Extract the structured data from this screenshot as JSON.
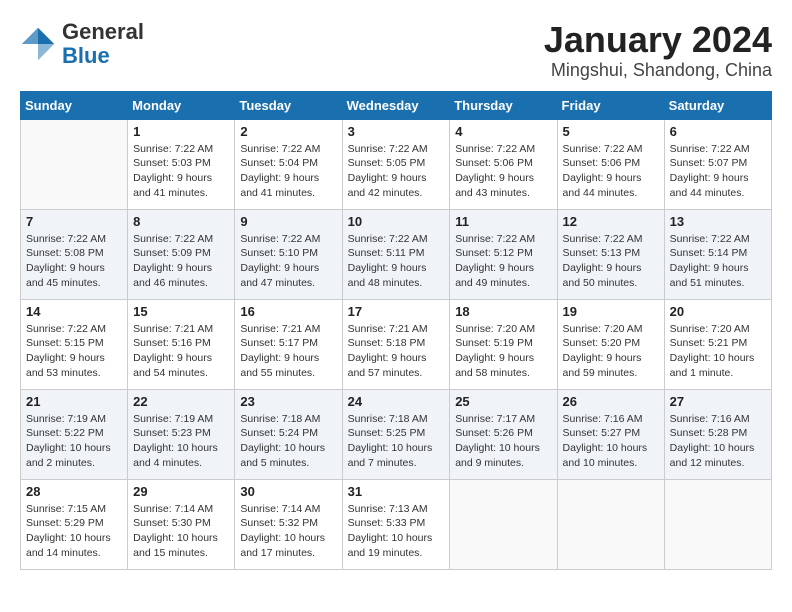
{
  "header": {
    "logo": {
      "general": "General",
      "blue": "Blue"
    },
    "title": "January 2024",
    "location": "Mingshui, Shandong, China"
  },
  "weekdays": [
    "Sunday",
    "Monday",
    "Tuesday",
    "Wednesday",
    "Thursday",
    "Friday",
    "Saturday"
  ],
  "weeks": [
    [
      {
        "day": null
      },
      {
        "day": "1",
        "sunrise": "7:22 AM",
        "sunset": "5:03 PM",
        "daylight": "9 hours and 41 minutes."
      },
      {
        "day": "2",
        "sunrise": "7:22 AM",
        "sunset": "5:04 PM",
        "daylight": "9 hours and 41 minutes."
      },
      {
        "day": "3",
        "sunrise": "7:22 AM",
        "sunset": "5:05 PM",
        "daylight": "9 hours and 42 minutes."
      },
      {
        "day": "4",
        "sunrise": "7:22 AM",
        "sunset": "5:06 PM",
        "daylight": "9 hours and 43 minutes."
      },
      {
        "day": "5",
        "sunrise": "7:22 AM",
        "sunset": "5:06 PM",
        "daylight": "9 hours and 44 minutes."
      },
      {
        "day": "6",
        "sunrise": "7:22 AM",
        "sunset": "5:07 PM",
        "daylight": "9 hours and 44 minutes."
      }
    ],
    [
      {
        "day": "7",
        "sunrise": "7:22 AM",
        "sunset": "5:08 PM",
        "daylight": "9 hours and 45 minutes."
      },
      {
        "day": "8",
        "sunrise": "7:22 AM",
        "sunset": "5:09 PM",
        "daylight": "9 hours and 46 minutes."
      },
      {
        "day": "9",
        "sunrise": "7:22 AM",
        "sunset": "5:10 PM",
        "daylight": "9 hours and 47 minutes."
      },
      {
        "day": "10",
        "sunrise": "7:22 AM",
        "sunset": "5:11 PM",
        "daylight": "9 hours and 48 minutes."
      },
      {
        "day": "11",
        "sunrise": "7:22 AM",
        "sunset": "5:12 PM",
        "daylight": "9 hours and 49 minutes."
      },
      {
        "day": "12",
        "sunrise": "7:22 AM",
        "sunset": "5:13 PM",
        "daylight": "9 hours and 50 minutes."
      },
      {
        "day": "13",
        "sunrise": "7:22 AM",
        "sunset": "5:14 PM",
        "daylight": "9 hours and 51 minutes."
      }
    ],
    [
      {
        "day": "14",
        "sunrise": "7:22 AM",
        "sunset": "5:15 PM",
        "daylight": "9 hours and 53 minutes."
      },
      {
        "day": "15",
        "sunrise": "7:21 AM",
        "sunset": "5:16 PM",
        "daylight": "9 hours and 54 minutes."
      },
      {
        "day": "16",
        "sunrise": "7:21 AM",
        "sunset": "5:17 PM",
        "daylight": "9 hours and 55 minutes."
      },
      {
        "day": "17",
        "sunrise": "7:21 AM",
        "sunset": "5:18 PM",
        "daylight": "9 hours and 57 minutes."
      },
      {
        "day": "18",
        "sunrise": "7:20 AM",
        "sunset": "5:19 PM",
        "daylight": "9 hours and 58 minutes."
      },
      {
        "day": "19",
        "sunrise": "7:20 AM",
        "sunset": "5:20 PM",
        "daylight": "9 hours and 59 minutes."
      },
      {
        "day": "20",
        "sunrise": "7:20 AM",
        "sunset": "5:21 PM",
        "daylight": "10 hours and 1 minute."
      }
    ],
    [
      {
        "day": "21",
        "sunrise": "7:19 AM",
        "sunset": "5:22 PM",
        "daylight": "10 hours and 2 minutes."
      },
      {
        "day": "22",
        "sunrise": "7:19 AM",
        "sunset": "5:23 PM",
        "daylight": "10 hours and 4 minutes."
      },
      {
        "day": "23",
        "sunrise": "7:18 AM",
        "sunset": "5:24 PM",
        "daylight": "10 hours and 5 minutes."
      },
      {
        "day": "24",
        "sunrise": "7:18 AM",
        "sunset": "5:25 PM",
        "daylight": "10 hours and 7 minutes."
      },
      {
        "day": "25",
        "sunrise": "7:17 AM",
        "sunset": "5:26 PM",
        "daylight": "10 hours and 9 minutes."
      },
      {
        "day": "26",
        "sunrise": "7:16 AM",
        "sunset": "5:27 PM",
        "daylight": "10 hours and 10 minutes."
      },
      {
        "day": "27",
        "sunrise": "7:16 AM",
        "sunset": "5:28 PM",
        "daylight": "10 hours and 12 minutes."
      }
    ],
    [
      {
        "day": "28",
        "sunrise": "7:15 AM",
        "sunset": "5:29 PM",
        "daylight": "10 hours and 14 minutes."
      },
      {
        "day": "29",
        "sunrise": "7:14 AM",
        "sunset": "5:30 PM",
        "daylight": "10 hours and 15 minutes."
      },
      {
        "day": "30",
        "sunrise": "7:14 AM",
        "sunset": "5:32 PM",
        "daylight": "10 hours and 17 minutes."
      },
      {
        "day": "31",
        "sunrise": "7:13 AM",
        "sunset": "5:33 PM",
        "daylight": "10 hours and 19 minutes."
      },
      {
        "day": null
      },
      {
        "day": null
      },
      {
        "day": null
      }
    ]
  ]
}
